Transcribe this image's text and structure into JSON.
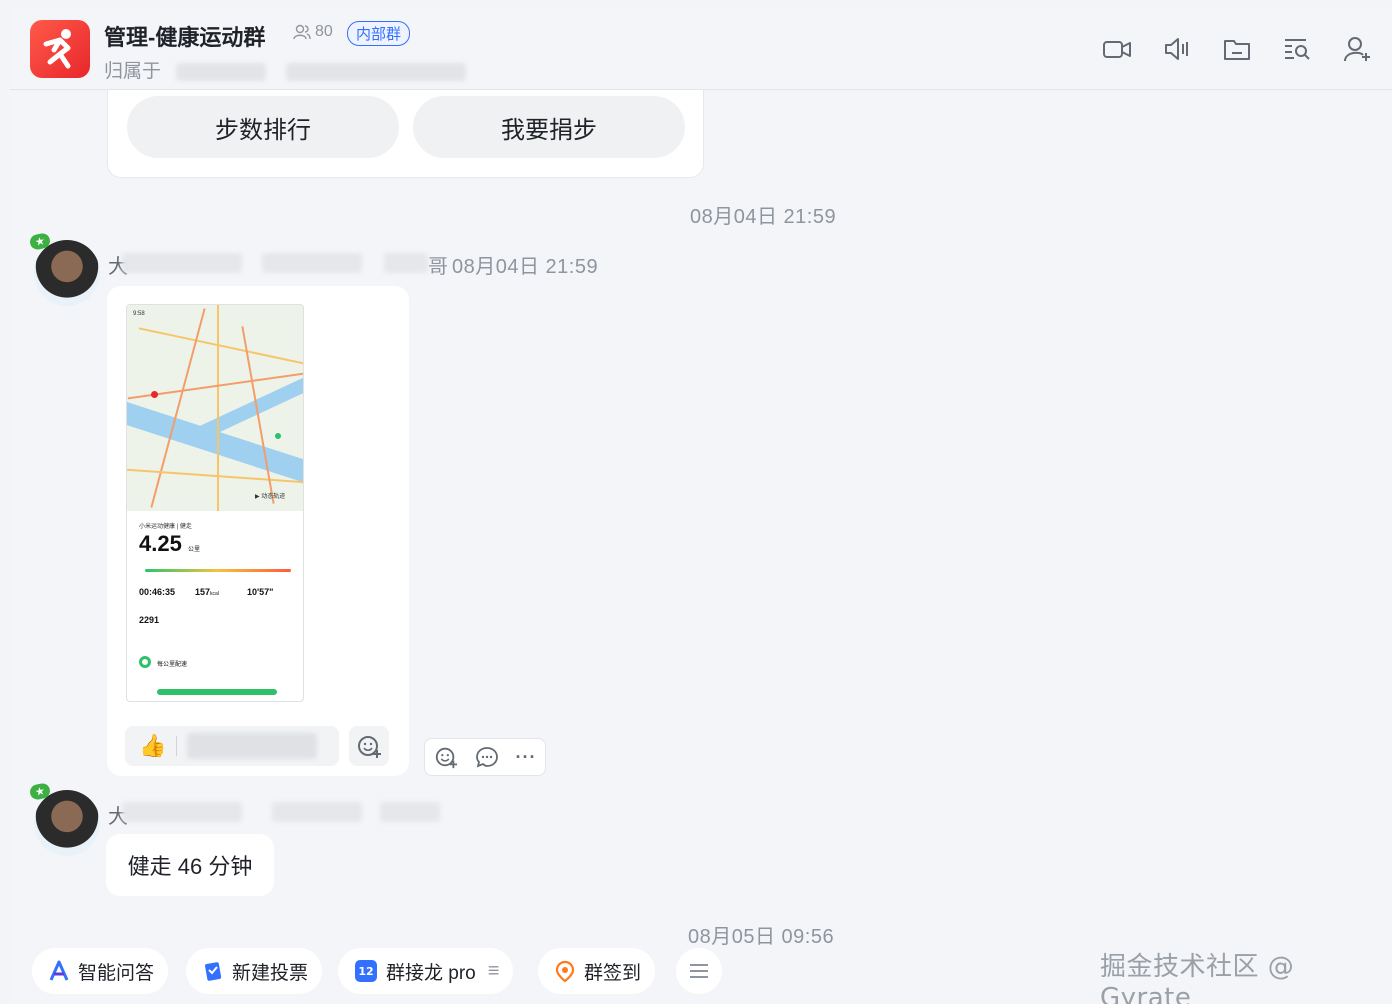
{
  "header": {
    "title": "管理-健康运动群",
    "member_count": "80",
    "badge": "内部群",
    "subtitle": "归属于"
  },
  "card": {
    "buttons": [
      "步数排行",
      "我要捐步"
    ]
  },
  "timestamps": {
    "ts1": "08月04日 21:59",
    "msg1_time": "08月04日 21:59",
    "ts2": "08月05日 09:56"
  },
  "message1": {
    "sender_initial": "大",
    "sender_suffix": "哥",
    "workout": {
      "app_title": "小米运动健康 | 健走",
      "distance": "4.25",
      "distance_unit": "公里",
      "duration": "00:46:35",
      "calories": "157",
      "calories_unit": "kcal",
      "pace": "10'57\"",
      "steps": "2291",
      "section": "每公里配速",
      "track_label": "动态轨迹",
      "time": "9:58"
    }
  },
  "message2": {
    "sender_initial": "大",
    "text": "健走 46 分钟"
  },
  "toolbar": {
    "items": [
      {
        "label": "智能问答",
        "icon": "ai-a-icon",
        "color": "#3370ff"
      },
      {
        "label": "新建投票",
        "icon": "vote-icon",
        "color": "#3370ff"
      },
      {
        "label": "群接龙 pro",
        "icon": "jielong-icon",
        "color": "#3370ff"
      },
      {
        "label": "群签到",
        "icon": "checkin-icon",
        "color": "#ff7a1a"
      }
    ]
  },
  "watermark": "掘金技术社区 @ Gyrate",
  "colors": {
    "accent": "#3370ff",
    "app_icon": "#e8262b",
    "green": "#2fc06a"
  }
}
